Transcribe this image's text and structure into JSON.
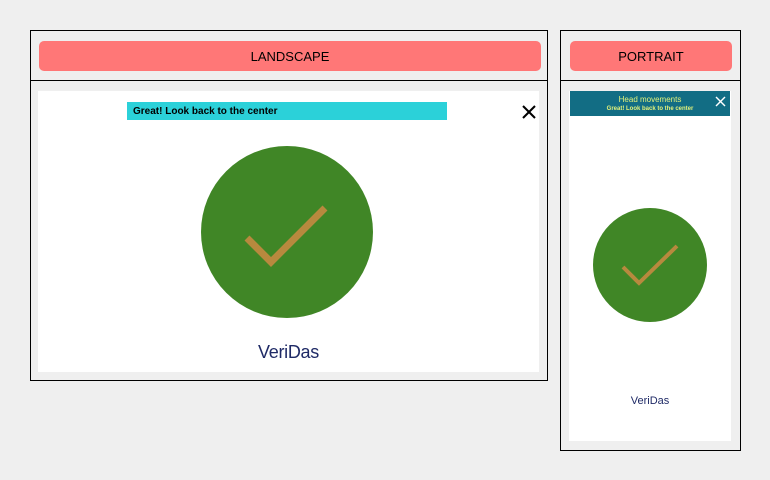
{
  "landscape": {
    "label": "LANDSCAPE",
    "banner": "Great! Look back to the center",
    "logo": "VeriDas"
  },
  "portrait": {
    "label": "PORTRAIT",
    "banner_title": "Head movements",
    "banner_subtitle": "Great! Look back to the center",
    "logo": "VeriDas"
  },
  "icons": {
    "close": "close-icon",
    "success": "check-circle-icon"
  },
  "colors": {
    "label_bg": "#ff7777",
    "landscape_banner": "#2bd1d9",
    "portrait_banner": "#126d84",
    "portrait_banner_text": "#e2f27a",
    "success_circle": "#408626",
    "check_mark": "#b8893e",
    "logo": "#1f2a66"
  }
}
